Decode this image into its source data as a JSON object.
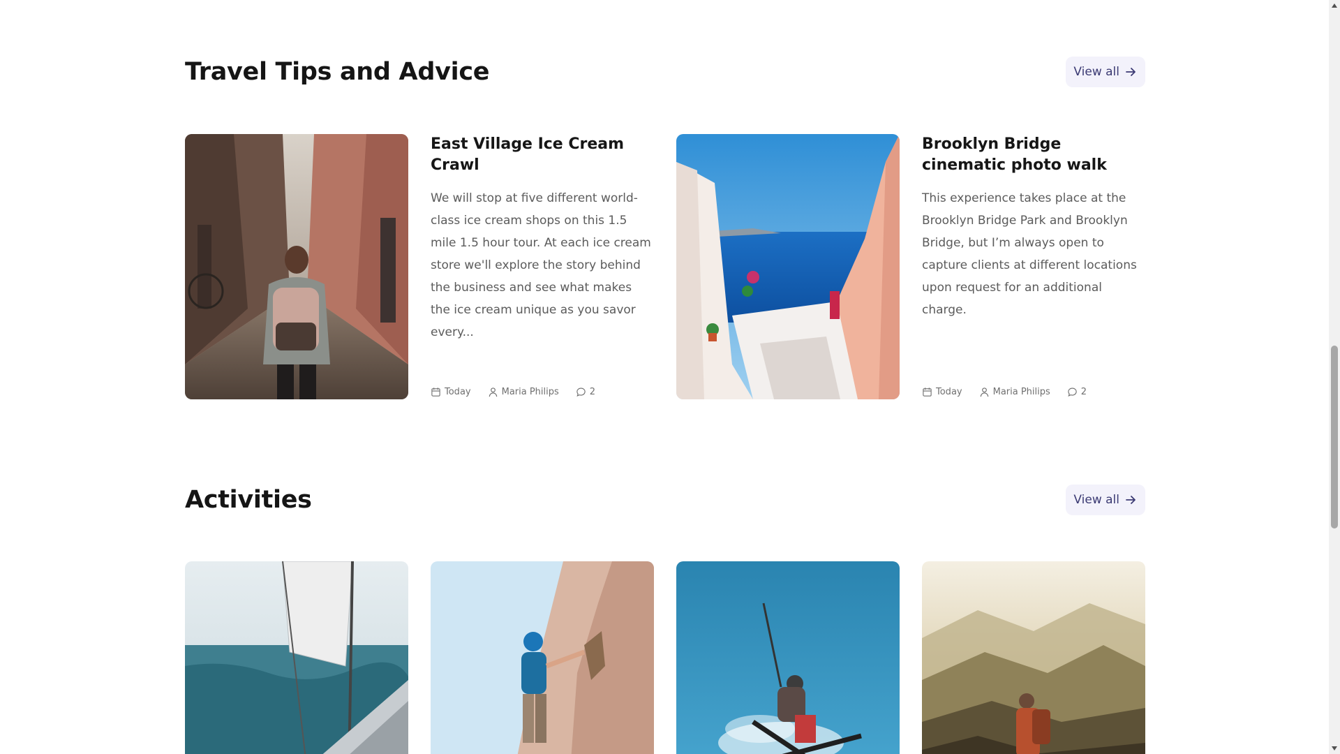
{
  "sections": {
    "travel": {
      "title": "Travel Tips and Advice",
      "view_all": "View all",
      "posts": [
        {
          "title": "East Village Ice Cream Crawl",
          "excerpt": "We will stop at five different world-class ice cream shops on this 1.5 mile 1.5 hour tour. At each ice cream store we'll explore the story behind the business and see what makes the ice cream unique as you savor every...",
          "date": "Today",
          "author": "Maria Philips",
          "comments": "2",
          "image_icon": "alley-backpacker-photo"
        },
        {
          "title": "Brooklyn Bridge cinematic photo walk",
          "excerpt": "This experience takes place at the Brooklyn Bridge Park and Brooklyn Bridge, but I’m always open to capture clients at different locations upon request for an additional charge.",
          "date": "Today",
          "author": "Maria Philips",
          "comments": "2",
          "image_icon": "santorini-stairs-photo"
        }
      ]
    },
    "activities": {
      "title": "Activities",
      "view_all": "View all",
      "items": [
        {
          "image_icon": "sailboat-photo"
        },
        {
          "image_icon": "rock-climber-photo"
        },
        {
          "image_icon": "skier-jump-photo"
        },
        {
          "image_icon": "mountain-hiker-photo"
        }
      ]
    }
  },
  "colors": {
    "accent_text": "#3b3a73",
    "button_bg": "#f3f2fb",
    "heading": "#151515",
    "body_text": "#5b5b5b",
    "meta_text": "#6f6f6f"
  }
}
